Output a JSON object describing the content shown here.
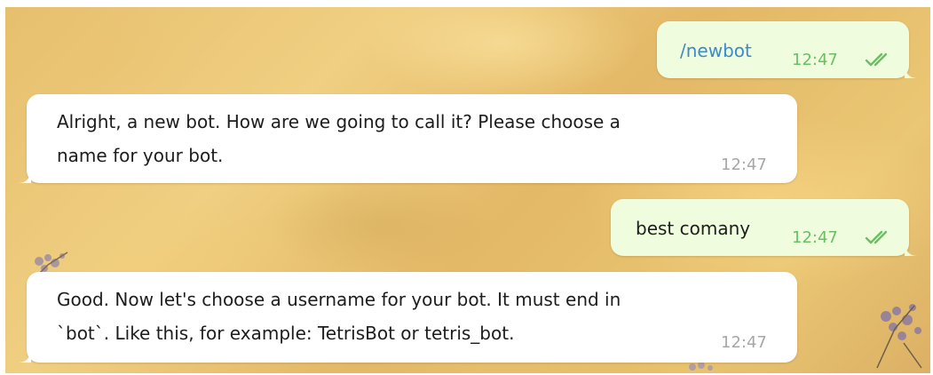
{
  "messages": [
    {
      "direction": "outgoing",
      "text": "/newbot",
      "time": "12:47",
      "status": "read",
      "status_icon": "double-check-icon"
    },
    {
      "direction": "incoming",
      "lines": [
        "Alright, a new bot. How are we going to call it? Please choose a",
        "name for your bot."
      ],
      "time": "12:47"
    },
    {
      "direction": "outgoing",
      "text": "best comany",
      "time": "12:47",
      "status": "read",
      "status_icon": "double-check-icon"
    },
    {
      "direction": "incoming",
      "lines": [
        "Good. Now let's choose a username for your bot. It must end in",
        "`bot`. Like this, for example: TetrisBot or tetris_bot."
      ],
      "time": "12:47"
    }
  ],
  "colors": {
    "outgoing_bubble": "#effdde",
    "incoming_bubble": "#ffffff",
    "command_text": "#3a8bc9",
    "outgoing_meta": "#6abf63",
    "incoming_meta": "#a7a7a7"
  }
}
